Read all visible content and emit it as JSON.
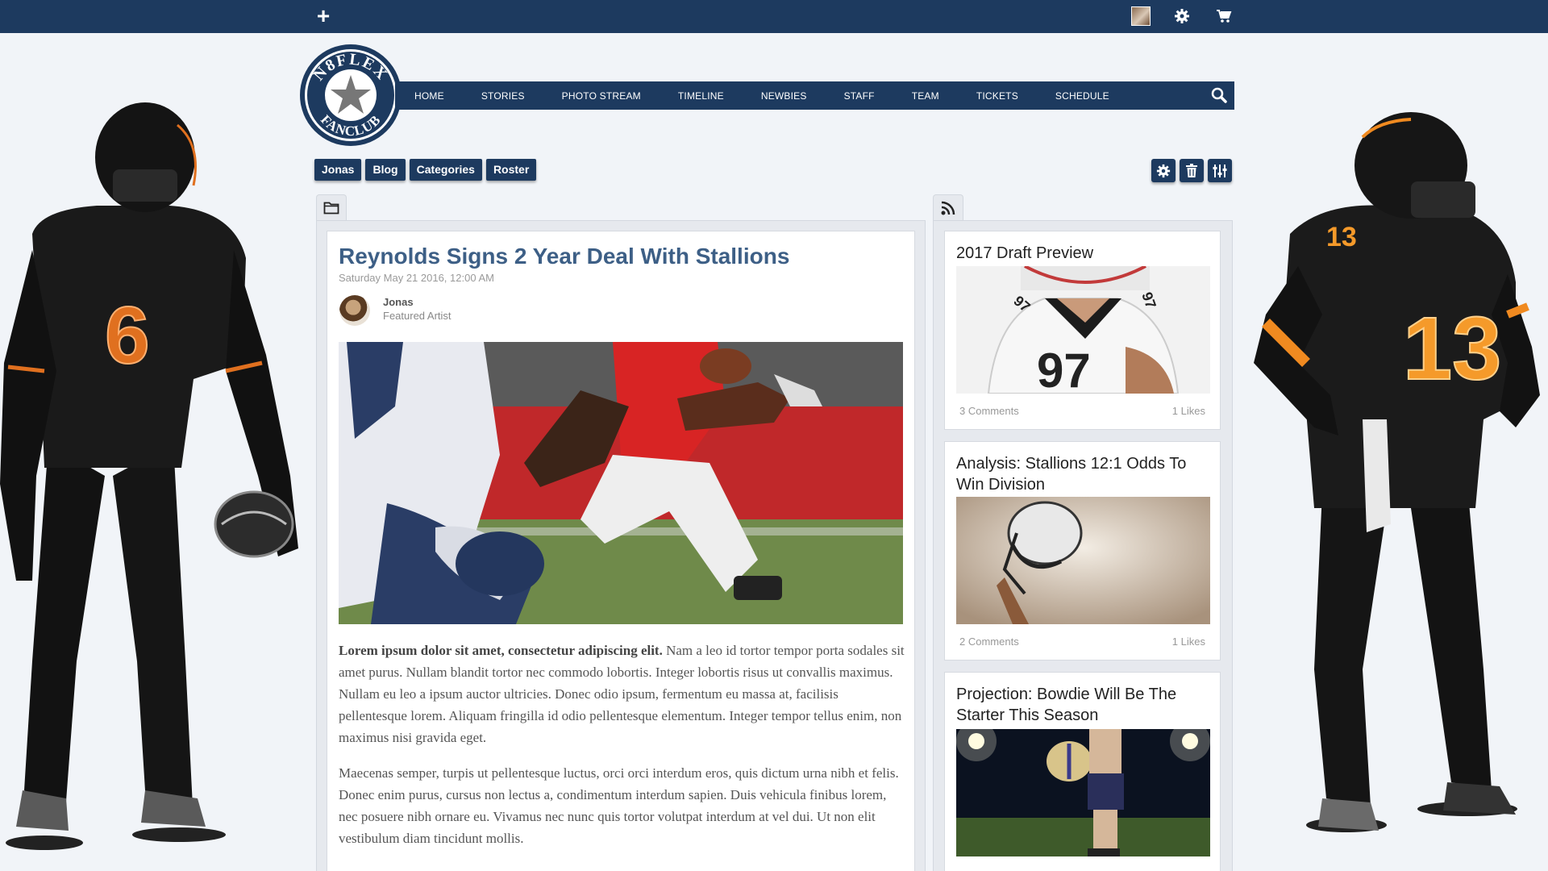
{
  "topbar": {
    "add_label": "+",
    "icons": [
      "user-avatar-icon",
      "gear-icon",
      "cart-icon"
    ]
  },
  "brand": {
    "logo_top": "N8FLEX",
    "logo_bottom": "FANCLUB",
    "primary_color": "#1d3a5f",
    "accent_color": "#3d5f86"
  },
  "nav": {
    "items": [
      "HOME",
      "STORIES",
      "PHOTO STREAM",
      "TIMELINE",
      "NEWBIES",
      "STAFF",
      "TEAM",
      "TICKETS",
      "SCHEDULE"
    ]
  },
  "tabs": [
    "Jonas",
    "Blog",
    "Categories",
    "Roster"
  ],
  "tools": [
    "gear-icon",
    "trash-icon",
    "sliders-icon"
  ],
  "article": {
    "title": "Reynolds Signs 2 Year Deal With Stallions",
    "date": "Saturday May 21 2016, 12:00 AM",
    "author_name": "Jonas",
    "author_role": "Featured Artist",
    "lead": "Lorem ipsum dolor sit amet, consectetur adipiscing elit.",
    "para1_rest": " Nam a leo id tortor tempor porta sodales sit amet purus. Nullam blandit tortor nec commodo lobortis. Integer lobortis risus ut convallis maximus. Nullam eu leo a ipsum auctor ultricies. Donec odio ipsum, fermentum eu massa at, facilisis pellentesque lorem. Aliquam fringilla id odio pellentesque elementum. Integer tempor tellus enim, non maximus nisi gravida eget.",
    "para2": "Maecenas semper, turpis ut pellentesque luctus, orci orci interdum eros, quis dictum urna nibh et felis. Donec enim purus, cursus non lectus a, condimentum interdum sapien. Duis vehicula finibus lorem, nec posuere nibh ornare eu. Vivamus nec nunc quis tortor volutpat interdum at vel dui. Ut non elit vestibulum diam tincidunt mollis."
  },
  "sidebar": {
    "cards": [
      {
        "title": "2017 Draft Preview",
        "comments": "3 Comments",
        "likes": "1 Likes"
      },
      {
        "title": "Analysis: Stallions 12:1 Odds To Win Division",
        "comments": "2 Comments",
        "likes": "1 Likes"
      },
      {
        "title": "Projection: Bowdie Will Be The Starter This Season",
        "comments": "",
        "likes": ""
      }
    ]
  }
}
